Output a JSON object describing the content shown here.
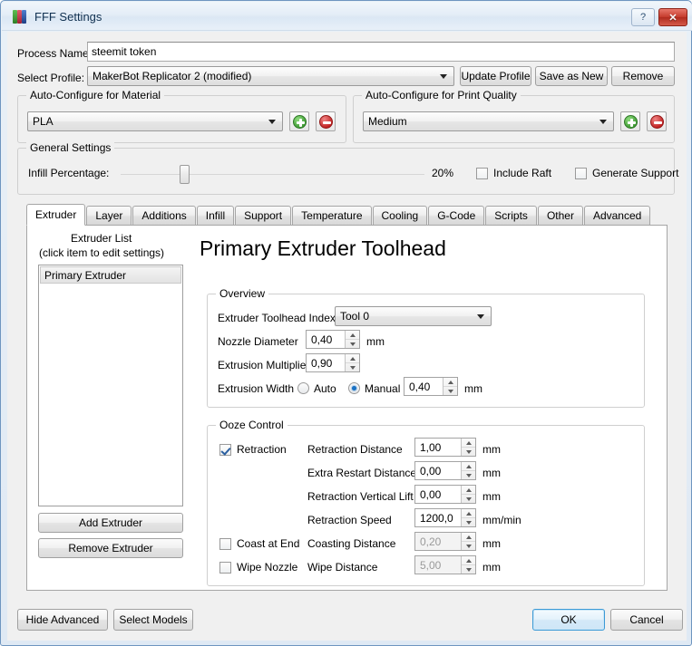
{
  "window": {
    "title": "FFF Settings",
    "app_icon": "printer-filament-icon",
    "help_label": "?",
    "close_label": "✕",
    "accent": "#3c9ad6",
    "titlebar_color": "#e4edf7"
  },
  "header": {
    "process_name_label": "Process Name:",
    "process_name_value": "steemit token",
    "process_name_placeholder": "Process Name",
    "select_profile_label": "Select Profile:",
    "select_profile_value": "MakerBot Replicator 2 (modified)",
    "buttons": [
      {
        "name": "update-profile",
        "label": "Update Profile"
      },
      {
        "name": "save-as-new",
        "label": "Save as New"
      },
      {
        "name": "remove-profile",
        "label": "Remove"
      }
    ]
  },
  "auto_material": {
    "title": "Auto-Configure for Material",
    "value": "PLA",
    "add_label": "+",
    "remove_label": "−"
  },
  "auto_quality": {
    "title": "Auto-Configure for Print Quality",
    "value": "Medium",
    "add_label": "+",
    "remove_label": "−"
  },
  "general": {
    "title": "General Settings",
    "infill_label": "Infill Percentage:",
    "infill_value": "20%",
    "infill_percent": 20,
    "include_raft_label": "Include Raft",
    "include_raft_checked": false,
    "generate_support_label": "Generate Support",
    "generate_support_checked": false
  },
  "tabs": [
    {
      "label": "Extruder",
      "active": true
    },
    {
      "label": "Layer",
      "active": false
    },
    {
      "label": "Additions",
      "active": false
    },
    {
      "label": "Infill",
      "active": false
    },
    {
      "label": "Support",
      "active": false
    },
    {
      "label": "Temperature",
      "active": false
    },
    {
      "label": "Cooling",
      "active": false
    },
    {
      "label": "G-Code",
      "active": false
    },
    {
      "label": "Scripts",
      "active": false
    },
    {
      "label": "Other",
      "active": false
    },
    {
      "label": "Advanced",
      "active": false
    }
  ],
  "extruder_panel": {
    "list_title_line1": "Extruder List",
    "list_title_line2": "(click item to edit settings)",
    "list_items": [
      {
        "label": "Primary Extruder",
        "selected": true
      }
    ],
    "add_extruder_label": "Add Extruder",
    "remove_extruder_label": "Remove Extruder",
    "heading": "Primary Extruder Toolhead",
    "overview": {
      "title": "Overview",
      "toolhead_index_label": "Extruder Toolhead Index",
      "toolhead_index_value": "Tool 0",
      "nozzle_diameter_label": "Nozzle Diameter",
      "nozzle_diameter_value": "0,40",
      "nozzle_diameter_unit": "mm",
      "extrusion_multiplier_label": "Extrusion Multiplier",
      "extrusion_multiplier_value": "0,90",
      "extrusion_width_label": "Extrusion Width",
      "extrusion_width_auto_label": "Auto",
      "extrusion_width_manual_label": "Manual",
      "extrusion_width_mode": "Manual",
      "extrusion_width_value": "0,40",
      "extrusion_width_unit": "mm"
    },
    "ooze": {
      "title": "Ooze Control",
      "retraction_label": "Retraction",
      "retraction_checked": true,
      "coast_label": "Coast at End",
      "coast_checked": false,
      "wipe_label": "Wipe Nozzle",
      "wipe_checked": false,
      "rows": [
        {
          "label": "Retraction Distance",
          "value": "1,00",
          "unit": "mm",
          "enabled": true
        },
        {
          "label": "Extra Restart Distance",
          "value": "0,00",
          "unit": "mm",
          "enabled": true
        },
        {
          "label": "Retraction Vertical Lift",
          "value": "0,00",
          "unit": "mm",
          "enabled": true
        },
        {
          "label": "Retraction Speed",
          "value": "1200,0",
          "unit": "mm/min",
          "enabled": true
        },
        {
          "label": "Coasting Distance",
          "value": "0,20",
          "unit": "mm",
          "enabled": false
        },
        {
          "label": "Wipe Distance",
          "value": "5,00",
          "unit": "mm",
          "enabled": false
        }
      ]
    }
  },
  "footer": {
    "hide_advanced_label": "Hide Advanced",
    "select_models_label": "Select Models",
    "ok_label": "OK",
    "cancel_label": "Cancel"
  }
}
